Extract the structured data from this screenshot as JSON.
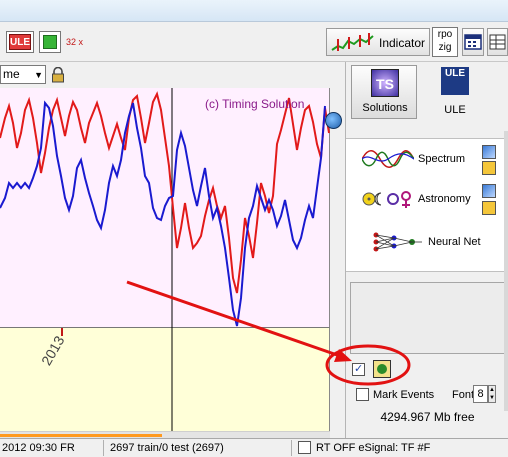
{
  "toolbar": {
    "ule_label": "ULE",
    "x32_label": "32 x",
    "indicator_label": "Indicator",
    "rpo_label": "rpo",
    "zig_label": "zig"
  },
  "chart_toolbar": {
    "time_combo_value": "me"
  },
  "chart": {
    "watermark": "(c) Timing Solution",
    "year_label": "2013",
    "colors": {
      "series_a": "#e21a1a",
      "series_b": "#1a1ad0",
      "plot_bg": "#fff0ff",
      "timescale_bg": "#ffffd8"
    }
  },
  "chart_data": {
    "type": "line",
    "series": [
      {
        "values": []
      },
      {
        "values": []
      }
    ]
  },
  "side_panel": {
    "solutions_label": "Solutions",
    "ule_icon_text": "ULE",
    "ule_label": "ULE",
    "ts_icon_text": "TS",
    "menu": [
      {
        "label": "Spectrum",
        "icon": "spectrum-wave-icon"
      },
      {
        "label": "Astronomy",
        "icon": "planet-symbols-icon"
      },
      {
        "label": "Neural Net",
        "icon": "neural-net-icon"
      }
    ],
    "mark_events_label": "Mark Events",
    "mark_events_checked": false,
    "neural_check_checked": true,
    "font_label": "Font",
    "font_value": "8",
    "memory_free": "4294.967 Mb free"
  },
  "statusbar": {
    "datetime": "2012  09:30 FR",
    "train_test": "2697 train/0 test (2697)",
    "signal": "RT OFF eSignal: TF #F"
  },
  "scroll": {
    "h_position": 0.49
  }
}
